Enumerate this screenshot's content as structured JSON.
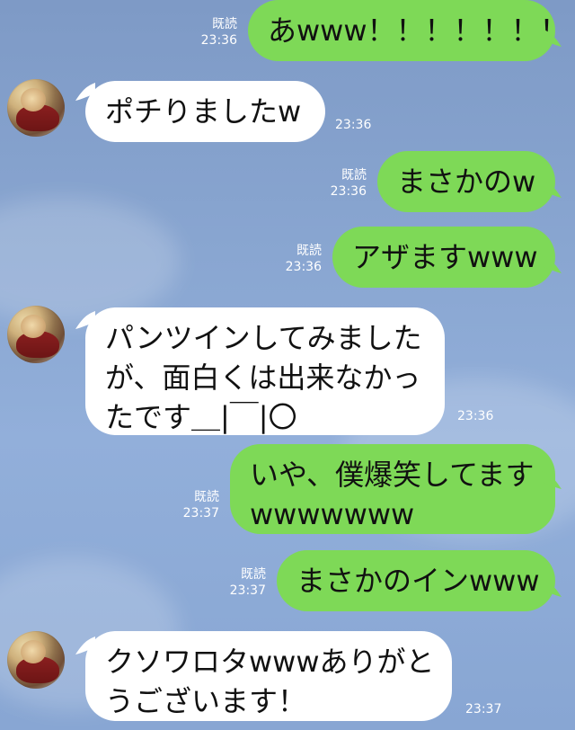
{
  "chat": {
    "messages": [
      {
        "id": "m1",
        "sender": "me",
        "lines": [
          "あwww！！！！！！！"
        ],
        "read": "既読",
        "time": "23:36"
      },
      {
        "id": "m2",
        "sender": "other",
        "lines": [
          "ポチりましたw"
        ],
        "time": "23:36"
      },
      {
        "id": "m3",
        "sender": "me",
        "lines": [
          "まさかのw"
        ],
        "read": "既読",
        "time": "23:36"
      },
      {
        "id": "m4",
        "sender": "me",
        "lines": [
          "アザますwww"
        ],
        "read": "既読",
        "time": "23:36"
      },
      {
        "id": "m5",
        "sender": "other",
        "lines": [
          "パンツインしてみました",
          "が、面白くは出来なかっ",
          "たです＿|￣|〇"
        ],
        "time": "23:36"
      },
      {
        "id": "m6",
        "sender": "me",
        "lines": [
          "いや、僕爆笑してます",
          "wwwwwww"
        ],
        "read": "既読",
        "time": "23:37"
      },
      {
        "id": "m7",
        "sender": "me",
        "lines": [
          "まさかのインwww"
        ],
        "read": "既読",
        "time": "23:37"
      },
      {
        "id": "m8",
        "sender": "other",
        "lines": [
          "クソワロタwwwありがと",
          "うございます！"
        ],
        "time": "23:37"
      }
    ]
  },
  "colors": {
    "outgoing_bubble": "#7ed957",
    "incoming_bubble": "#ffffff",
    "meta_text": "#ffffff"
  },
  "icons": {
    "avatar": "avatar-icon"
  }
}
